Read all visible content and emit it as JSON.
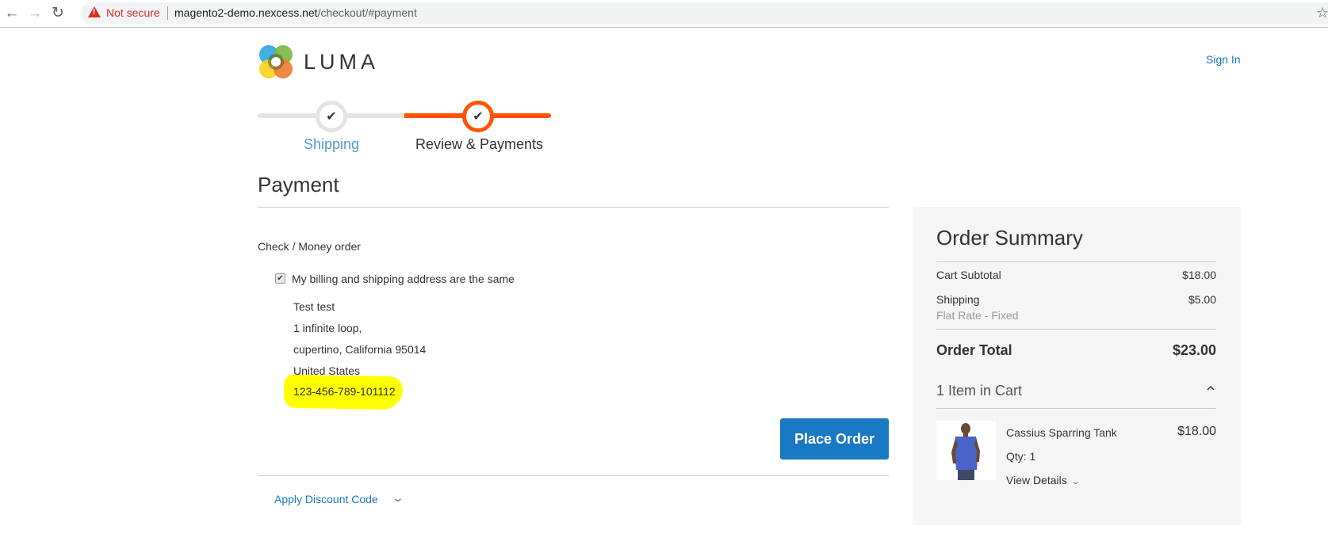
{
  "browser": {
    "security_label": "Not secure",
    "url_host": "magento2-demo.nexcess.net",
    "url_path": "/checkout/#payment",
    "back_glyph": "←",
    "forward_glyph": "→",
    "reload_glyph": "↻",
    "star_glyph": "☆"
  },
  "header": {
    "brand": "LUMA",
    "sign_in": "Sign In"
  },
  "progress": {
    "steps": [
      {
        "label": "Shipping",
        "status": "complete",
        "glyph": "✔"
      },
      {
        "label": "Review & Payments",
        "status": "active",
        "glyph": "✔"
      }
    ],
    "colors": {
      "active": "#ff5501",
      "inactive": "#e4e4e4",
      "link": "#1979c3"
    }
  },
  "payment": {
    "title": "Payment",
    "method": "Check / Money order",
    "same_address_checked": true,
    "same_address_glyph": "✔",
    "same_address_label": "My billing and shipping address are the same",
    "address": {
      "name": "Test test",
      "street": "1 infinite loop,",
      "city_region_zip": "cupertino, California 95014",
      "country": "United States",
      "phone": "123-456-789-101112"
    },
    "highlight_color": "#ffff00",
    "place_order": "Place Order",
    "discount_label": "Apply Discount Code",
    "discount_chevron": "⌄"
  },
  "summary": {
    "title": "Order Summary",
    "cart_subtotal_label": "Cart Subtotal",
    "cart_subtotal": "$18.00",
    "shipping_label": "Shipping",
    "shipping_method": "Flat Rate - Fixed",
    "shipping": "$5.00",
    "total_label": "Order Total",
    "total": "$23.00",
    "items_label": "1 Item in Cart",
    "items": [
      {
        "name": "Cassius Sparring Tank",
        "price": "$18.00",
        "qty": "Qty: 1",
        "details_label": "View Details",
        "details_chevron": "⌄"
      }
    ]
  }
}
